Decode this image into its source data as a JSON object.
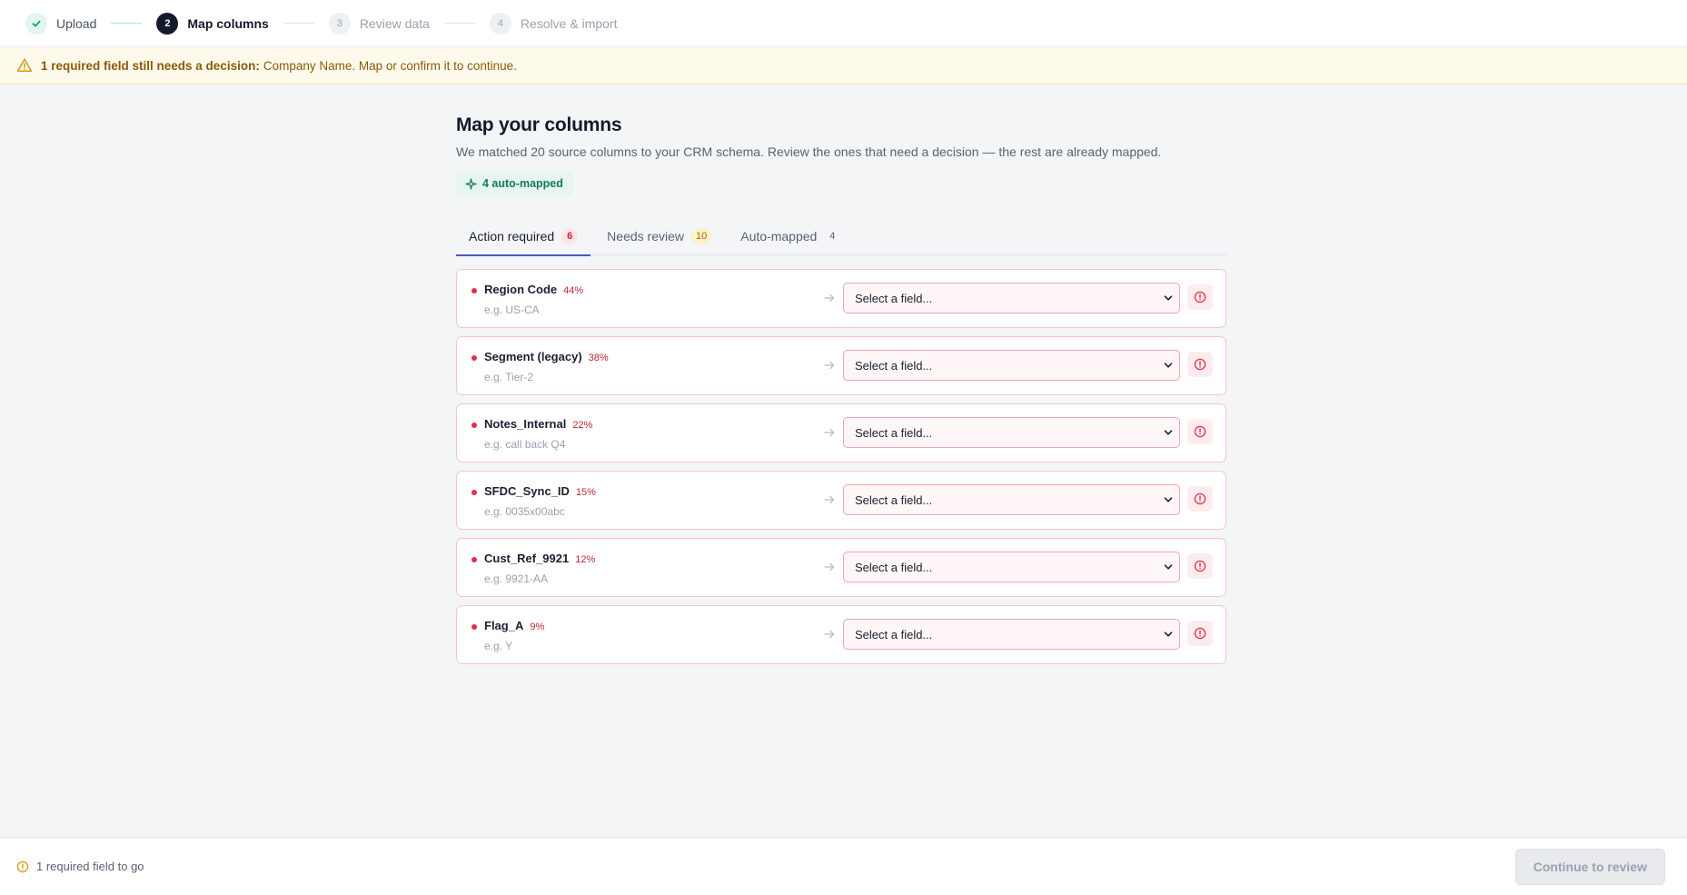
{
  "stepper": {
    "steps": [
      {
        "number": "✓",
        "label": "Upload",
        "state": "done"
      },
      {
        "number": "2",
        "label": "Map columns",
        "state": "active"
      },
      {
        "number": "3",
        "label": "Review data",
        "state": "pending"
      },
      {
        "number": "4",
        "label": "Resolve & import",
        "state": "pending"
      }
    ]
  },
  "banner": {
    "bold_text": "1 required field still needs a decision:",
    "text": "Company Name. Map or confirm it to continue."
  },
  "header": {
    "title": "Map your columns",
    "subtitle": "We matched 20 source columns to your CRM schema. Review the ones that need a decision — the rest are already mapped.",
    "chip_label": "4 auto-mapped"
  },
  "tabs": [
    {
      "label": "Action required",
      "count": "6"
    },
    {
      "label": "Needs review",
      "count": "10"
    },
    {
      "label": "Auto-mapped",
      "count": "4"
    }
  ],
  "rows": [
    {
      "name": "Region Code",
      "pct": "44%",
      "example": "e.g. US-CA",
      "select_placeholder": "Select a field..."
    },
    {
      "name": "Segment (legacy)",
      "pct": "38%",
      "example": "e.g. Tier-2",
      "select_placeholder": "Select a field..."
    },
    {
      "name": "Notes_Internal",
      "pct": "22%",
      "example": "e.g. call back Q4",
      "select_placeholder": "Select a field..."
    },
    {
      "name": "SFDC_Sync_ID",
      "pct": "15%",
      "example": "e.g. 0035x00abc",
      "select_placeholder": "Select a field..."
    },
    {
      "name": "Cust_Ref_9921",
      "pct": "12%",
      "example": "e.g. 9921-AA",
      "select_placeholder": "Select a field..."
    },
    {
      "name": "Flag_A",
      "pct": "9%",
      "example": "e.g. Y",
      "select_placeholder": "Select a field..."
    }
  ],
  "footer": {
    "status": "1 required field to go",
    "continue_label": "Continue to review"
  },
  "colors": {
    "accent": "#4b57c8",
    "danger": "#e0304b",
    "success": "#14a06a",
    "warning": "#d79a12"
  }
}
